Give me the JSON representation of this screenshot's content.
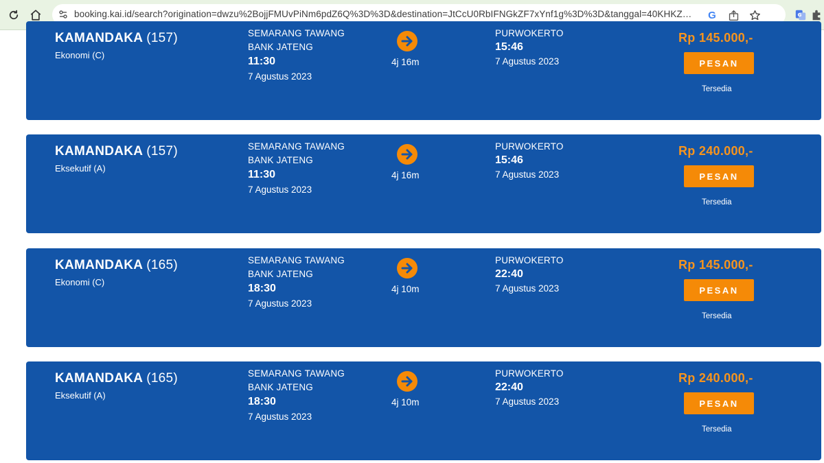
{
  "browser": {
    "url": "booking.kai.id/search?origination=dwzu%2BojjFMUvPiNm6pdZ6Q%3D%3D&destination=JtCcU0RbIFNGkZF7xYnf1g%3D%3D&tanggal=40KHKZ5sf..."
  },
  "colors": {
    "card_bg": "#1355a8",
    "price": "#f7941d",
    "button": "#f58a07"
  },
  "results": [
    {
      "train_name": "KAMANDAKA",
      "train_number": "(157)",
      "class": "Ekonomi (C)",
      "origin_line1": "SEMARANG TAWANG",
      "origin_line2": "BANK JATENG",
      "departure_time": "11:30",
      "departure_date": "7 Agustus 2023",
      "duration": "4j 16m",
      "destination": "PURWOKERTO",
      "arrival_time": "15:46",
      "arrival_date": "7 Agustus 2023",
      "price": "Rp 145.000,-",
      "button_label": "PESAN",
      "status": "Tersedia"
    },
    {
      "train_name": "KAMANDAKA",
      "train_number": "(157)",
      "class": "Eksekutif (A)",
      "origin_line1": "SEMARANG TAWANG",
      "origin_line2": "BANK JATENG",
      "departure_time": "11:30",
      "departure_date": "7 Agustus 2023",
      "duration": "4j 16m",
      "destination": "PURWOKERTO",
      "arrival_time": "15:46",
      "arrival_date": "7 Agustus 2023",
      "price": "Rp 240.000,-",
      "button_label": "PESAN",
      "status": "Tersedia"
    },
    {
      "train_name": "KAMANDAKA",
      "train_number": "(165)",
      "class": "Ekonomi (C)",
      "origin_line1": "SEMARANG TAWANG",
      "origin_line2": "BANK JATENG",
      "departure_time": "18:30",
      "departure_date": "7 Agustus 2023",
      "duration": "4j 10m",
      "destination": "PURWOKERTO",
      "arrival_time": "22:40",
      "arrival_date": "7 Agustus 2023",
      "price": "Rp 145.000,-",
      "button_label": "PESAN",
      "status": "Tersedia"
    },
    {
      "train_name": "KAMANDAKA",
      "train_number": "(165)",
      "class": "Eksekutif (A)",
      "origin_line1": "SEMARANG TAWANG",
      "origin_line2": "BANK JATENG",
      "departure_time": "18:30",
      "departure_date": "7 Agustus 2023",
      "duration": "4j 10m",
      "destination": "PURWOKERTO",
      "arrival_time": "22:40",
      "arrival_date": "7 Agustus 2023",
      "price": "Rp 240.000,-",
      "button_label": "PESAN",
      "status": "Tersedia"
    }
  ]
}
